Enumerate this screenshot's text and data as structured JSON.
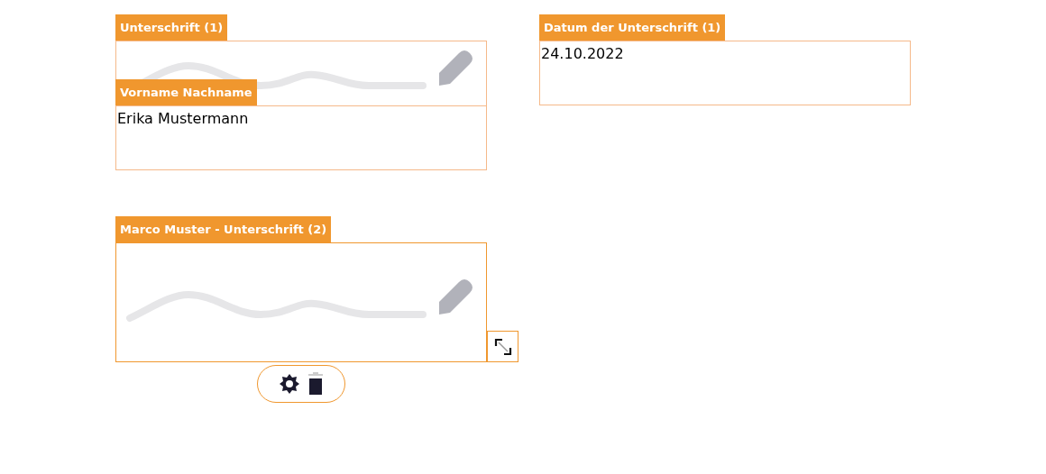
{
  "fields": [
    {
      "kind": "signature",
      "label": "Unterschrift (1)",
      "selected": false
    },
    {
      "kind": "text",
      "label": "Datum der Unterschrift (1)",
      "value": "24.10.2022",
      "selected": false
    },
    {
      "kind": "text",
      "label": "Vorname Nachname",
      "value": "Erika Mustermann",
      "selected": false
    },
    {
      "kind": "signature",
      "label": "Marco Muster - Unterschrift (2)",
      "selected": true
    }
  ]
}
